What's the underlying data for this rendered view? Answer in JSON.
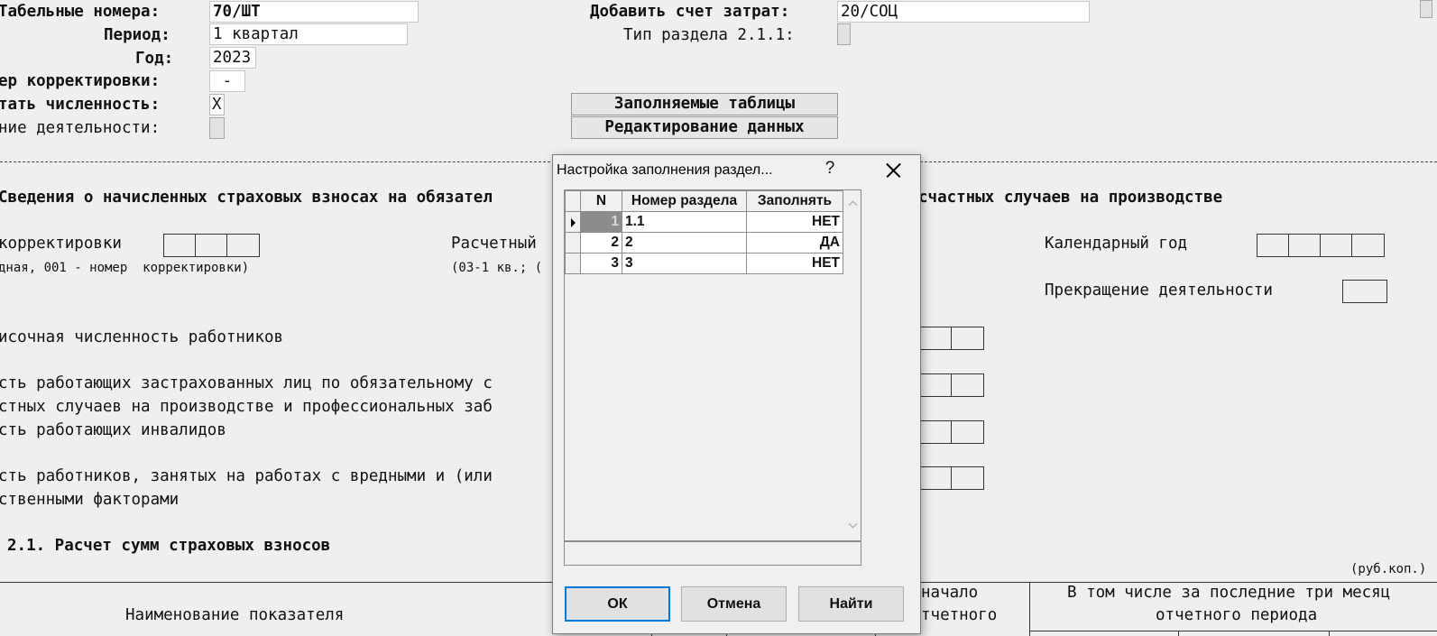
{
  "form": {
    "tab_numbers_label": "Табельные номера:",
    "tab_numbers_value": "70/ШТ",
    "period_label": "Период:",
    "period_value": "1 квартал",
    "year_label": "Год:",
    "year_value": "2023",
    "correction_label": "ер корректировки:",
    "correction_value": " -",
    "headcount_label": "тать численность:",
    "headcount_value": "X",
    "termination_label": "ние деятельности:",
    "cost_account_label": "Добавить счет затрат:",
    "cost_account_value": "20/СОЦ",
    "section_type_label": "Тип раздела 2.1.1:",
    "fill_tables_button": "Заполняемые таблицы",
    "edit_data_button": "Редактирование данных"
  },
  "report": {
    "heading_left": "Сведения о начисленных страховых взносах на обязател",
    "heading_right": "счастных случаев на производстве",
    "correction_text": "корректировки",
    "correction_note": "дная, 001 - номер  корректировки)",
    "calc_period_text": "Расчетный",
    "calc_period_note": "(03-1 кв.; (",
    "calendar_year_label": "Календарный год",
    "termination_label": "Прекращение деятельности",
    "line1": "исочная численность работников",
    "line2a": "сть работающих застрахованных лиц по обязательному с",
    "line2b": "стных случаев на производстве и профессиональных заб",
    "line3": "сть работающих инвалидов",
    "line4a": "сть работников, занятых на работах с вредными и (или",
    "line4b": "ственными факторами",
    "section_title": "2.1. Расчет сумм страховых взносов",
    "units": "(руб.коп.)",
    "col_indicator": "Наименование показателя",
    "col_start_a": "начало",
    "col_start_b": "тчетного",
    "col_last3_a": "В том числе за последние три месяц",
    "col_last3_b": "отчетного периода"
  },
  "dialog": {
    "title": "Настройка заполнения раздел...",
    "help": "?",
    "columns": [
      "N",
      "Номер раздела",
      "Заполнять"
    ],
    "rows": [
      {
        "n": "1",
        "section": "1.1",
        "fill": "НЕТ"
      },
      {
        "n": "2",
        "section": "2",
        "fill": "ДА"
      },
      {
        "n": "3",
        "section": "3",
        "fill": "НЕТ"
      }
    ],
    "ok_label": "ОК",
    "cancel_label": "Отмена",
    "find_label": "Найти"
  }
}
